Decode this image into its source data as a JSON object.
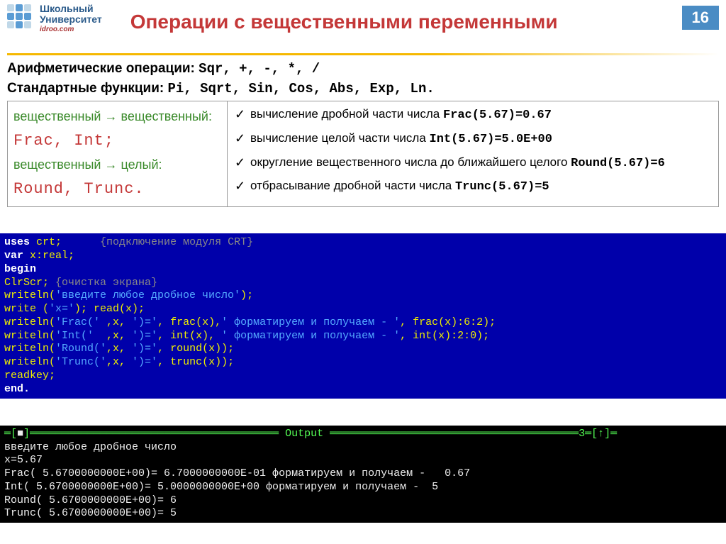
{
  "header": {
    "logo_line1": "Школьный",
    "logo_line2": "Университет",
    "logo_sub": "idroo.com",
    "title": "Операции с вещественными переменными",
    "page_num": "16"
  },
  "info": {
    "arith_label": "Арифметические операции:",
    "arith_ops": "  Sqr, +, -, *, /",
    "std_label": "Стандартные функции:",
    "std_fns": " Pi, Sqrt, Sin, Cos, Abs, Exp, Ln."
  },
  "left_box": {
    "to_real": "вещественный → вещественный:",
    "real_fns": "Frac, Int;",
    "to_int": "вещественный → целый:",
    "int_fns": "Round, Trunc."
  },
  "bullets": [
    {
      "text": "вычисление дробной части числа ",
      "code": "Frac(5.67)=0.67"
    },
    {
      "text": "вычисление целой части числа ",
      "code": "Int(5.67)=5.0E+00"
    },
    {
      "text": "округление вещественного числа до ближайшего целого ",
      "code": "Round(5.67)=6"
    },
    {
      "text": "отбрасывание дробной части числа ",
      "code": "Trunc(5.67)=5"
    }
  ],
  "code": {
    "l1a": "uses",
    "l1b": " crt;      ",
    "l1c": "{подключение модуля CRT}",
    "l2a": "var",
    "l2b": " x:real;",
    "l3": "begin",
    "l4a": "ClrScr; ",
    "l4b": "{очистка экрана}",
    "l5a": "writeln(",
    "l5b": "'введите любое дробное число'",
    "l5c": ");",
    "l6a": "write (",
    "l6b": "'x='",
    "l6c": "); read(x);",
    "l7": "",
    "l8a": "writeln(",
    "l8b": "'Frac('",
    "l8c": " ,x, ",
    "l8d": "')='",
    "l8e": ", frac(x),",
    "l8f": "' форматируем и получаем - '",
    "l8g": ", frac(x):6:2);",
    "l9a": "writeln(",
    "l9b": "'Int('",
    "l9c": "  ,x, ",
    "l9d": "')='",
    "l9e": ", int(x), ",
    "l9f": "' форматируем и получаем - '",
    "l9g": ", int(x):2:0);",
    "l10a": "writeln(",
    "l10b": "'Round('",
    "l10c": ",x, ",
    "l10d": "')='",
    "l10e": ", round(x));",
    "l11a": "writeln(",
    "l11b": "'Trunc('",
    "l11c": ",x, ",
    "l11d": "')='",
    "l11e": ", trunc(x));",
    "l12": "readkey;",
    "l13": "end."
  },
  "output": {
    "header": " Output ",
    "right_marker": "3═[↑]═",
    "l1": "введите любое дробное число",
    "l2": "x=5.67",
    "l3": "Frac( 5.6700000000E+00)= 6.7000000000E-01 форматируем и получаем -   0.67",
    "l4": "Int( 5.6700000000E+00)= 5.0000000000E+00 форматируем и получаем -  5",
    "l5": "Round( 5.6700000000E+00)= 6",
    "l6": "Trunc( 5.6700000000E+00)= 5"
  }
}
